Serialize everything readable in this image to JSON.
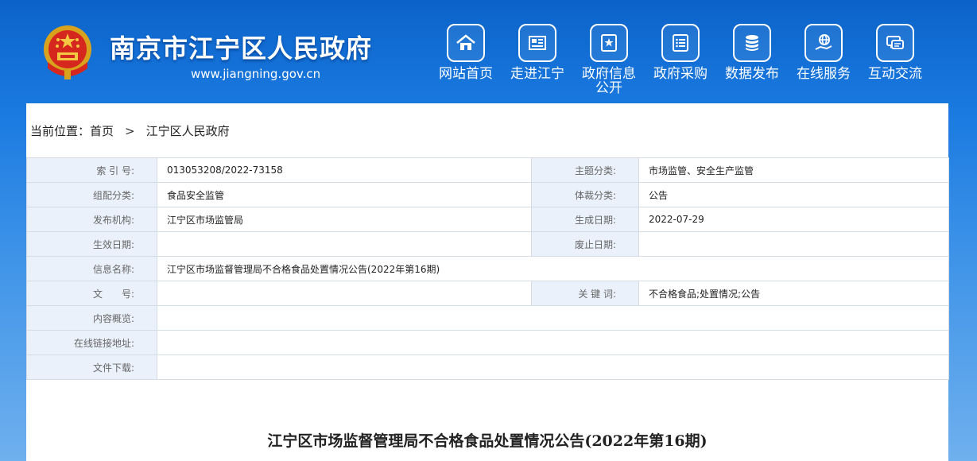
{
  "header": {
    "site_title": "南京市江宁区人民政府",
    "site_url": "www.jiangning.gov.cn",
    "emblem_icon": "national-emblem-icon"
  },
  "nav": [
    {
      "label": "网站首页",
      "icon": "home-icon"
    },
    {
      "label": "走进江宁",
      "icon": "newspaper-icon"
    },
    {
      "label": "政府信息\n公开",
      "icon": "document-star-icon"
    },
    {
      "label": "政府采购",
      "icon": "list-icon"
    },
    {
      "label": "数据发布",
      "icon": "database-icon"
    },
    {
      "label": "在线服务",
      "icon": "hand-globe-icon"
    },
    {
      "label": "互动交流",
      "icon": "chat-icon"
    }
  ],
  "breadcrumb": {
    "prefix": "当前位置：",
    "home": "首页",
    "separator": ">",
    "current": "江宁区人民政府"
  },
  "meta": {
    "index_no_label": "索 引 号:",
    "index_no": "013053208/2022-73158",
    "topic_label": "主题分类:",
    "topic": "市场监管、安全生产监管",
    "category_label": "组配分类:",
    "category": "食品安全监管",
    "genre_label": "体裁分类:",
    "genre": "公告",
    "publisher_label": "发布机构:",
    "publisher": "江宁区市场监管局",
    "created_label": "生成日期:",
    "created": "2022-07-29",
    "effective_label": "生效日期:",
    "effective": "",
    "expiry_label": "废止日期:",
    "expiry": "",
    "info_name_label": "信息名称:",
    "info_name": "江宁区市场监督管理局不合格食品处置情况公告(2022年第16期)",
    "doc_no_label": "文　　号:",
    "doc_no": "",
    "keywords_label": "关 键 词:",
    "keywords": "不合格食品;处置情况;公告",
    "summary_label": "内容概览:",
    "summary": "",
    "link_label": "在线链接地址:",
    "link": "",
    "download_label": "文件下载:",
    "download": ""
  },
  "article": {
    "title": "江宁区市场监督管理局不合格食品处置情况公告(2022年第16期)"
  },
  "colors": {
    "header_blue": "#0b63c9",
    "label_bg": "#eaf1fa",
    "border": "#d5dbe4"
  }
}
